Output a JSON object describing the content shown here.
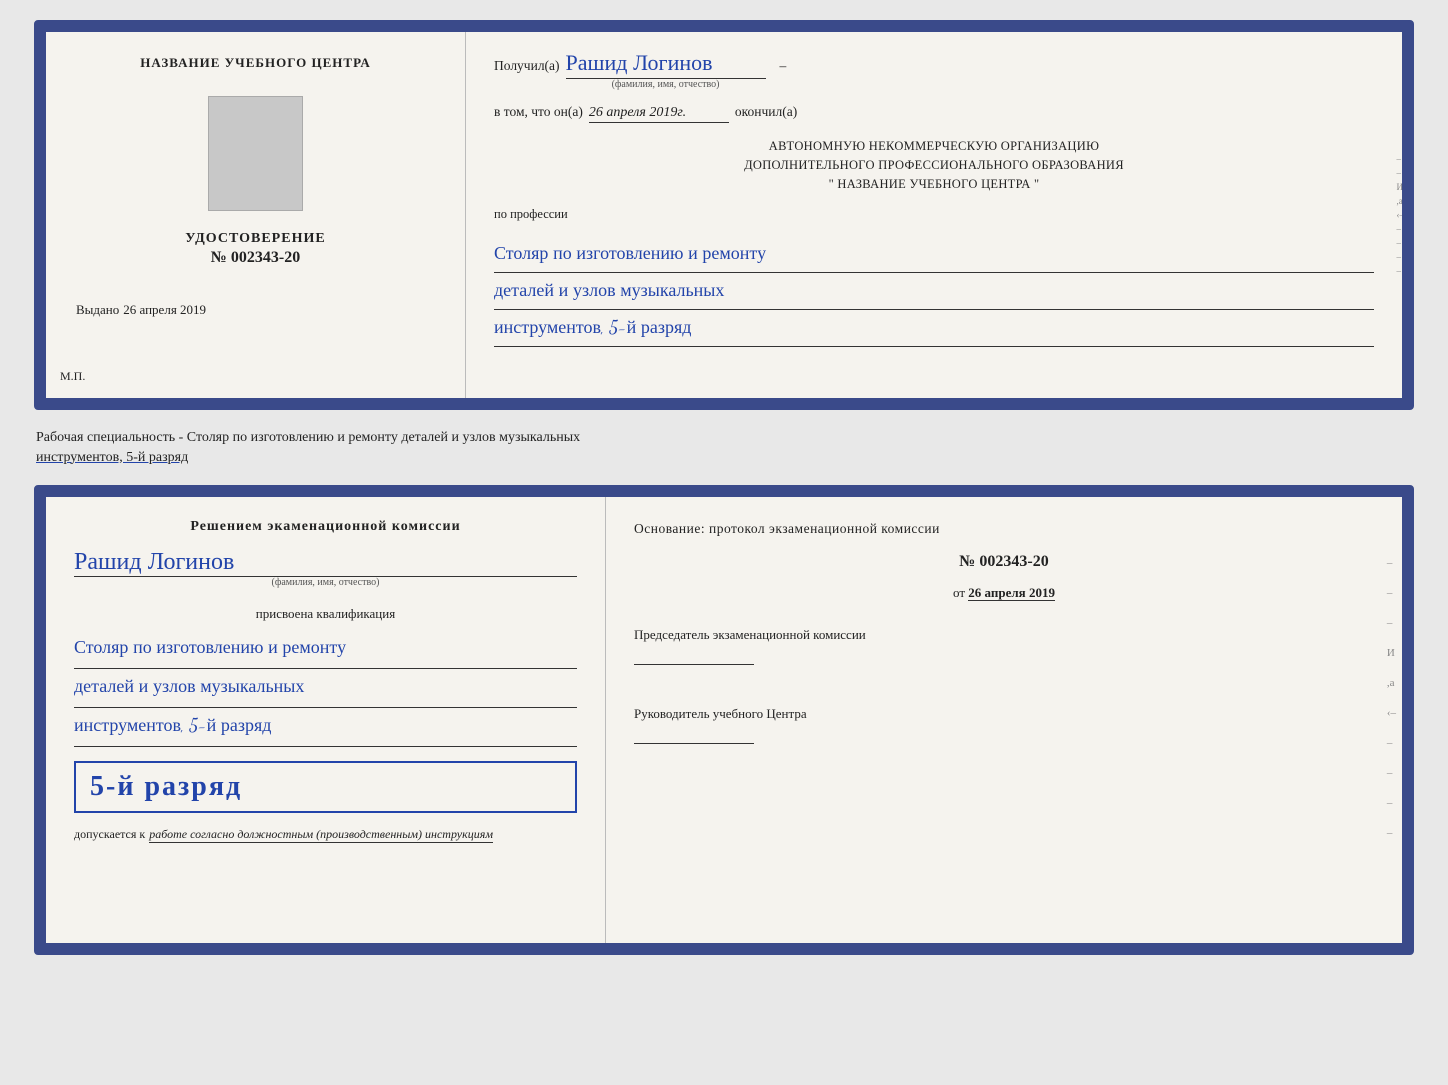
{
  "topDoc": {
    "left": {
      "headerText": "НАЗВАНИЕ УЧЕБНОГО ЦЕНТРА",
      "udostoverenie": "УДОСТОВЕРЕНИЕ",
      "number": "№ 002343-20",
      "vydanoLabel": "Выдано",
      "vydanoDate": "26 апреля 2019",
      "mp": "М.П."
    },
    "right": {
      "poluchilLabel": "Получил(a)",
      "recipientName": "Рашид Логинов",
      "fioSub": "(фамилия, имя, отчество)",
      "dash": "–",
      "vtomLabel": "в том, что он(а)",
      "date": "26 апреля 2019г.",
      "okonchilLabel": "окончил(а)",
      "orgLine1": "АВТОНОМНУЮ НЕКОММЕРЧЕСКУЮ ОРГАНИЗАЦИЮ",
      "orgLine2": "ДОПОЛНИТЕЛЬНОГО ПРОФЕССИОНАЛЬНОГО ОБРАЗОВАНИЯ",
      "orgLine3": "\"    НАЗВАНИЕ УЧЕБНОГО ЦЕНТРА    \"",
      "poProf": "по профессии",
      "profession1": "Столяр по изготовлению и ремонту",
      "profession2": "деталей и узлов музыкальных",
      "profession3": "инструментов, 5-й разряд"
    }
  },
  "middleLabel": {
    "prefix": "Рабочая специальность - Столяр по изготовлению и ремонту деталей и узлов музыкальных",
    "underlinedPart": "инструментов, 5-й разряд"
  },
  "bottomDoc": {
    "left": {
      "resheniem": "Решением экаменационной комиссии",
      "name": "Рашид Логинов",
      "fioSub": "(фамилия, имя, отчество)",
      "prisvoeena": "присвоена квалификация",
      "profession1": "Столяр по изготовлению и ремонту",
      "profession2": "деталей и узлов музыкальных",
      "profession3": "инструментов, 5-й разряд",
      "rankBoxText": "5-й разряд",
      "dopuskaetsya": "допускается к",
      "dopuskaetsyaItalic": "работе согласно должностным (производственным) инструкциям"
    },
    "right": {
      "osnovanie": "Основание: протокол экзаменационной комиссии",
      "protocolNumber": "№  002343-20",
      "otLabel": "от",
      "otDate": "26 апреля 2019",
      "predsedatel": "Председатель экзаменационной комиссии",
      "rukovoditel": "Руководитель учебного Центра",
      "dash1": "–",
      "dash2": "–",
      "dash3": "–",
      "dash4": "–",
      "dash5": "–",
      "dash6": "–",
      "sideDashes": [
        "–",
        "–",
        "–",
        "И",
        ",а",
        "‹–",
        "–",
        "–",
        "–",
        "–"
      ]
    }
  }
}
